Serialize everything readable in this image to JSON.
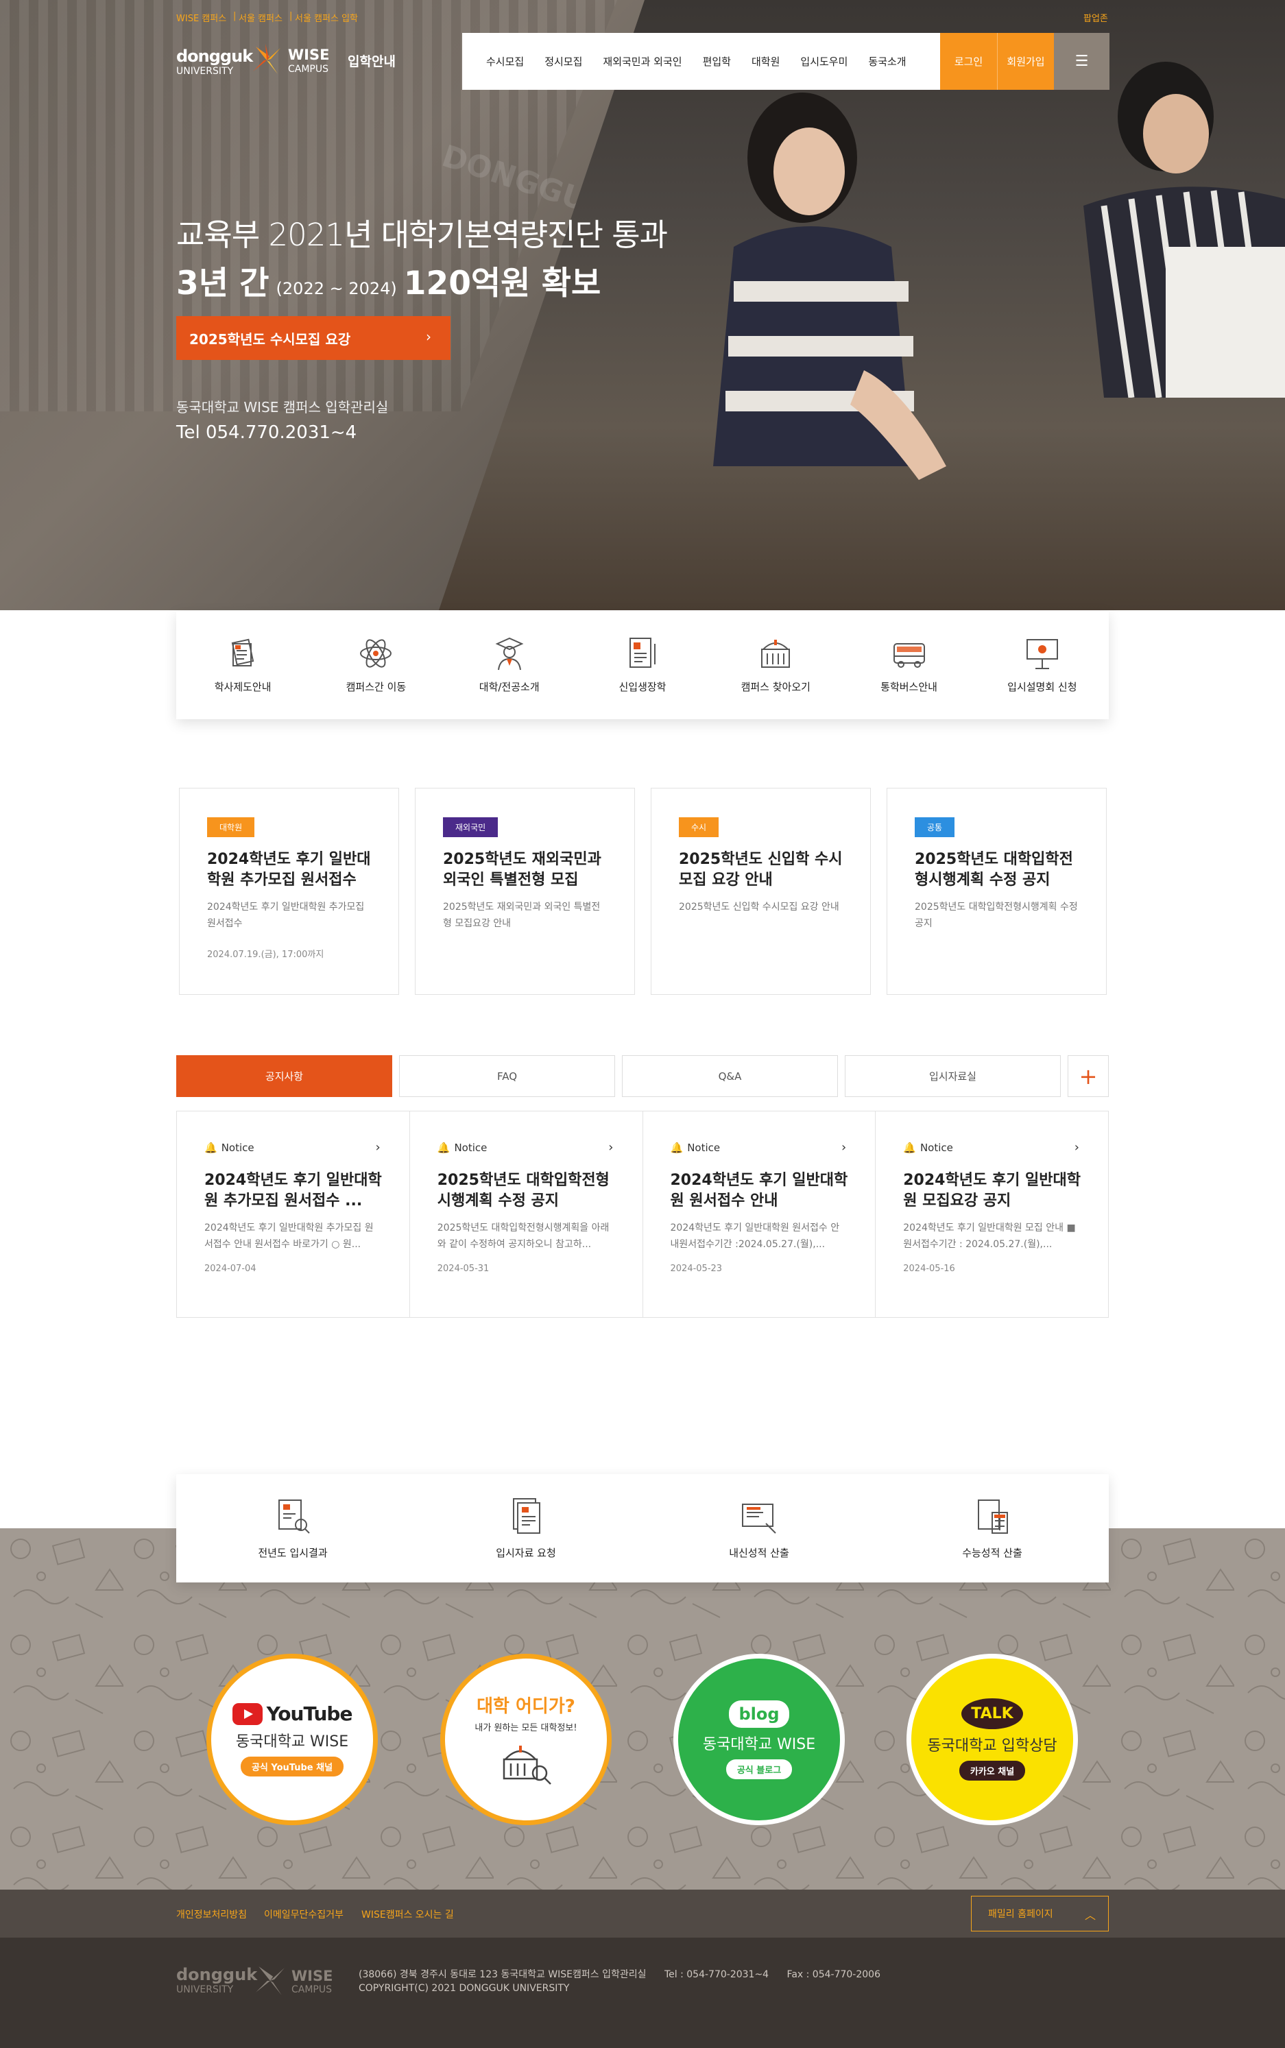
{
  "top_links": [
    "WISE 캠퍼스",
    "서울 캠퍼스",
    "서울 캠퍼스 입학"
  ],
  "popup_label": "팝업존",
  "logo": {
    "name": "dongguk",
    "sub": "UNIVERSITY",
    "campus": "WISE",
    "campus_sub": "CAMPUS",
    "section": "입학안내"
  },
  "nav": {
    "items": [
      "수시모집",
      "정시모집",
      "재외국민과 외국인",
      "편입학",
      "대학원",
      "입시도우미",
      "동국소개"
    ],
    "login": "로그인",
    "join": "회원가입"
  },
  "hero": {
    "line1": "교육부 2021년 대학기본역량진단 통과",
    "line2a": "3년 간",
    "line2b": "(2022 ~ 2024)",
    "line2c": "120억원 확보",
    "cta": "2025학년도 수시모집 요강",
    "office": "동국대학교 WISE 캠퍼스 입학관리실",
    "tel": "Tel 054.770.2031~4",
    "photo_text": "DONGGUK"
  },
  "quick_menu": [
    {
      "label": "학사제도안내",
      "icon": "document-stack-icon"
    },
    {
      "label": "캠퍼스간 이동",
      "icon": "atom-icon"
    },
    {
      "label": "대학/전공소개",
      "icon": "graduate-icon"
    },
    {
      "label": "신입생장학",
      "icon": "scholarship-doc-icon"
    },
    {
      "label": "캠퍼스 찾아오기",
      "icon": "building-icon"
    },
    {
      "label": "통학버스안내",
      "icon": "bus-icon"
    },
    {
      "label": "입시설명회 신청",
      "icon": "presentation-icon"
    }
  ],
  "cards": [
    {
      "badge": "대학원",
      "color": "#f7941d",
      "title": "2024학년도 후기 일반대학원 추가모집 원서접수 ...",
      "desc": "2024학년도 후기 일반대학원 추가모집 원서접수",
      "date": "2024.07.19.(금), 17:00까지"
    },
    {
      "badge": "재외국민",
      "color": "#4b2a8a",
      "title": "2025학년도 재외국민과 외국인 특별전형 모집요...",
      "desc": "2025학년도 재외국민과 외국인 특별전형 모집요강 안내",
      "date": ""
    },
    {
      "badge": "수시",
      "color": "#f7941d",
      "title": "2025학년도 신입학 수시모집 요강 안내",
      "desc": "2025학년도 신입학 수시모집 요강 안내",
      "date": ""
    },
    {
      "badge": "공통",
      "color": "#2c8fe0",
      "title": "2025학년도 대학입학전형시행계획 수정 공지",
      "desc": "2025학년도 대학입학전형시행계획 수정 공지",
      "date": ""
    }
  ],
  "tabs": [
    "공지사항",
    "FAQ",
    "Q&A",
    "입시자료실"
  ],
  "tab_more": "+",
  "notices": [
    {
      "label": "Notice",
      "title": "2024학년도 후기 일반대학원 추가모집 원서접수 ...",
      "desc": "2024학년도 후기 일반대학원 추가모집 원서접수 안내 원서접수 바로가기 ○ 원...",
      "date": "2024-07-04"
    },
    {
      "label": "Notice",
      "title": "2025학년도 대학입학전형시행계획 수정 공지",
      "desc": "2025학년도 대학입학전형시행계획을 아래와 같이 수정하여 공지하오니 참고하...",
      "date": "2024-05-31"
    },
    {
      "label": "Notice",
      "title": "2024학년도 후기 일반대학원 원서접수 안내",
      "desc": "2024학년도 후기 일반대학원 원서접수 안내원서접수기간 :2024.05.27.(월),...",
      "date": "2024-05-23"
    },
    {
      "label": "Notice",
      "title": "2024학년도 후기 일반대학원 모집요강 공지",
      "desc": "2024학년도 후기 일반대학원 모집 안내 ■ 원서접수기간 : 2024.05.27.(월),...",
      "date": "2024-05-16"
    }
  ],
  "quick_menu2": [
    {
      "label": "전년도 입시결과",
      "icon": "report-search-icon"
    },
    {
      "label": "입시자료 요청",
      "icon": "document-request-icon"
    },
    {
      "label": "내신성적 산출",
      "icon": "grade-calc-icon"
    },
    {
      "label": "수능성적 산출",
      "icon": "calculator-icon"
    }
  ],
  "sns": [
    {
      "logo": "YouTube",
      "title": "동국대학교 WISE",
      "pill": "공식 YouTube 채널",
      "border": "#f7a51a",
      "bg": "#ffffff",
      "pill_bg": "#f7941d"
    },
    {
      "logo": "대학 어디가?",
      "sub": "내가 원하는 모든 대학정보!",
      "border": "#f7a51a",
      "bg": "#ffffff"
    },
    {
      "logo": "blog",
      "title": "동국대학교 WISE",
      "pill": "공식 블로그",
      "border": "#ffffff",
      "bg": "#2db14a",
      "pill_bg": "#ffffff"
    },
    {
      "logo": "TALK",
      "title": "동국대학교 입학상담",
      "pill": "카카오 채널",
      "border": "#ffffff",
      "bg": "#fae100",
      "pill_bg": "#3a1d1d"
    }
  ],
  "footer": {
    "links": [
      "개인정보처리방침",
      "이메일무단수집거부",
      "WISE캠퍼스 오시는 길"
    ],
    "family": "패밀리 홈페이지",
    "address": "(38066) 경북 경주시 동대로 123 동국대학교 WISE캠퍼스 입학관리실",
    "tel": "Tel : 054-770-2031~4",
    "fax": "Fax : 054-770-2006",
    "copyright": "COPYRIGHT(C) 2021 DONGGUK UNIVERSITY"
  },
  "colors": {
    "primary": "#e4541a",
    "accent": "#f7941d",
    "footer_dark": "#3b3531"
  }
}
